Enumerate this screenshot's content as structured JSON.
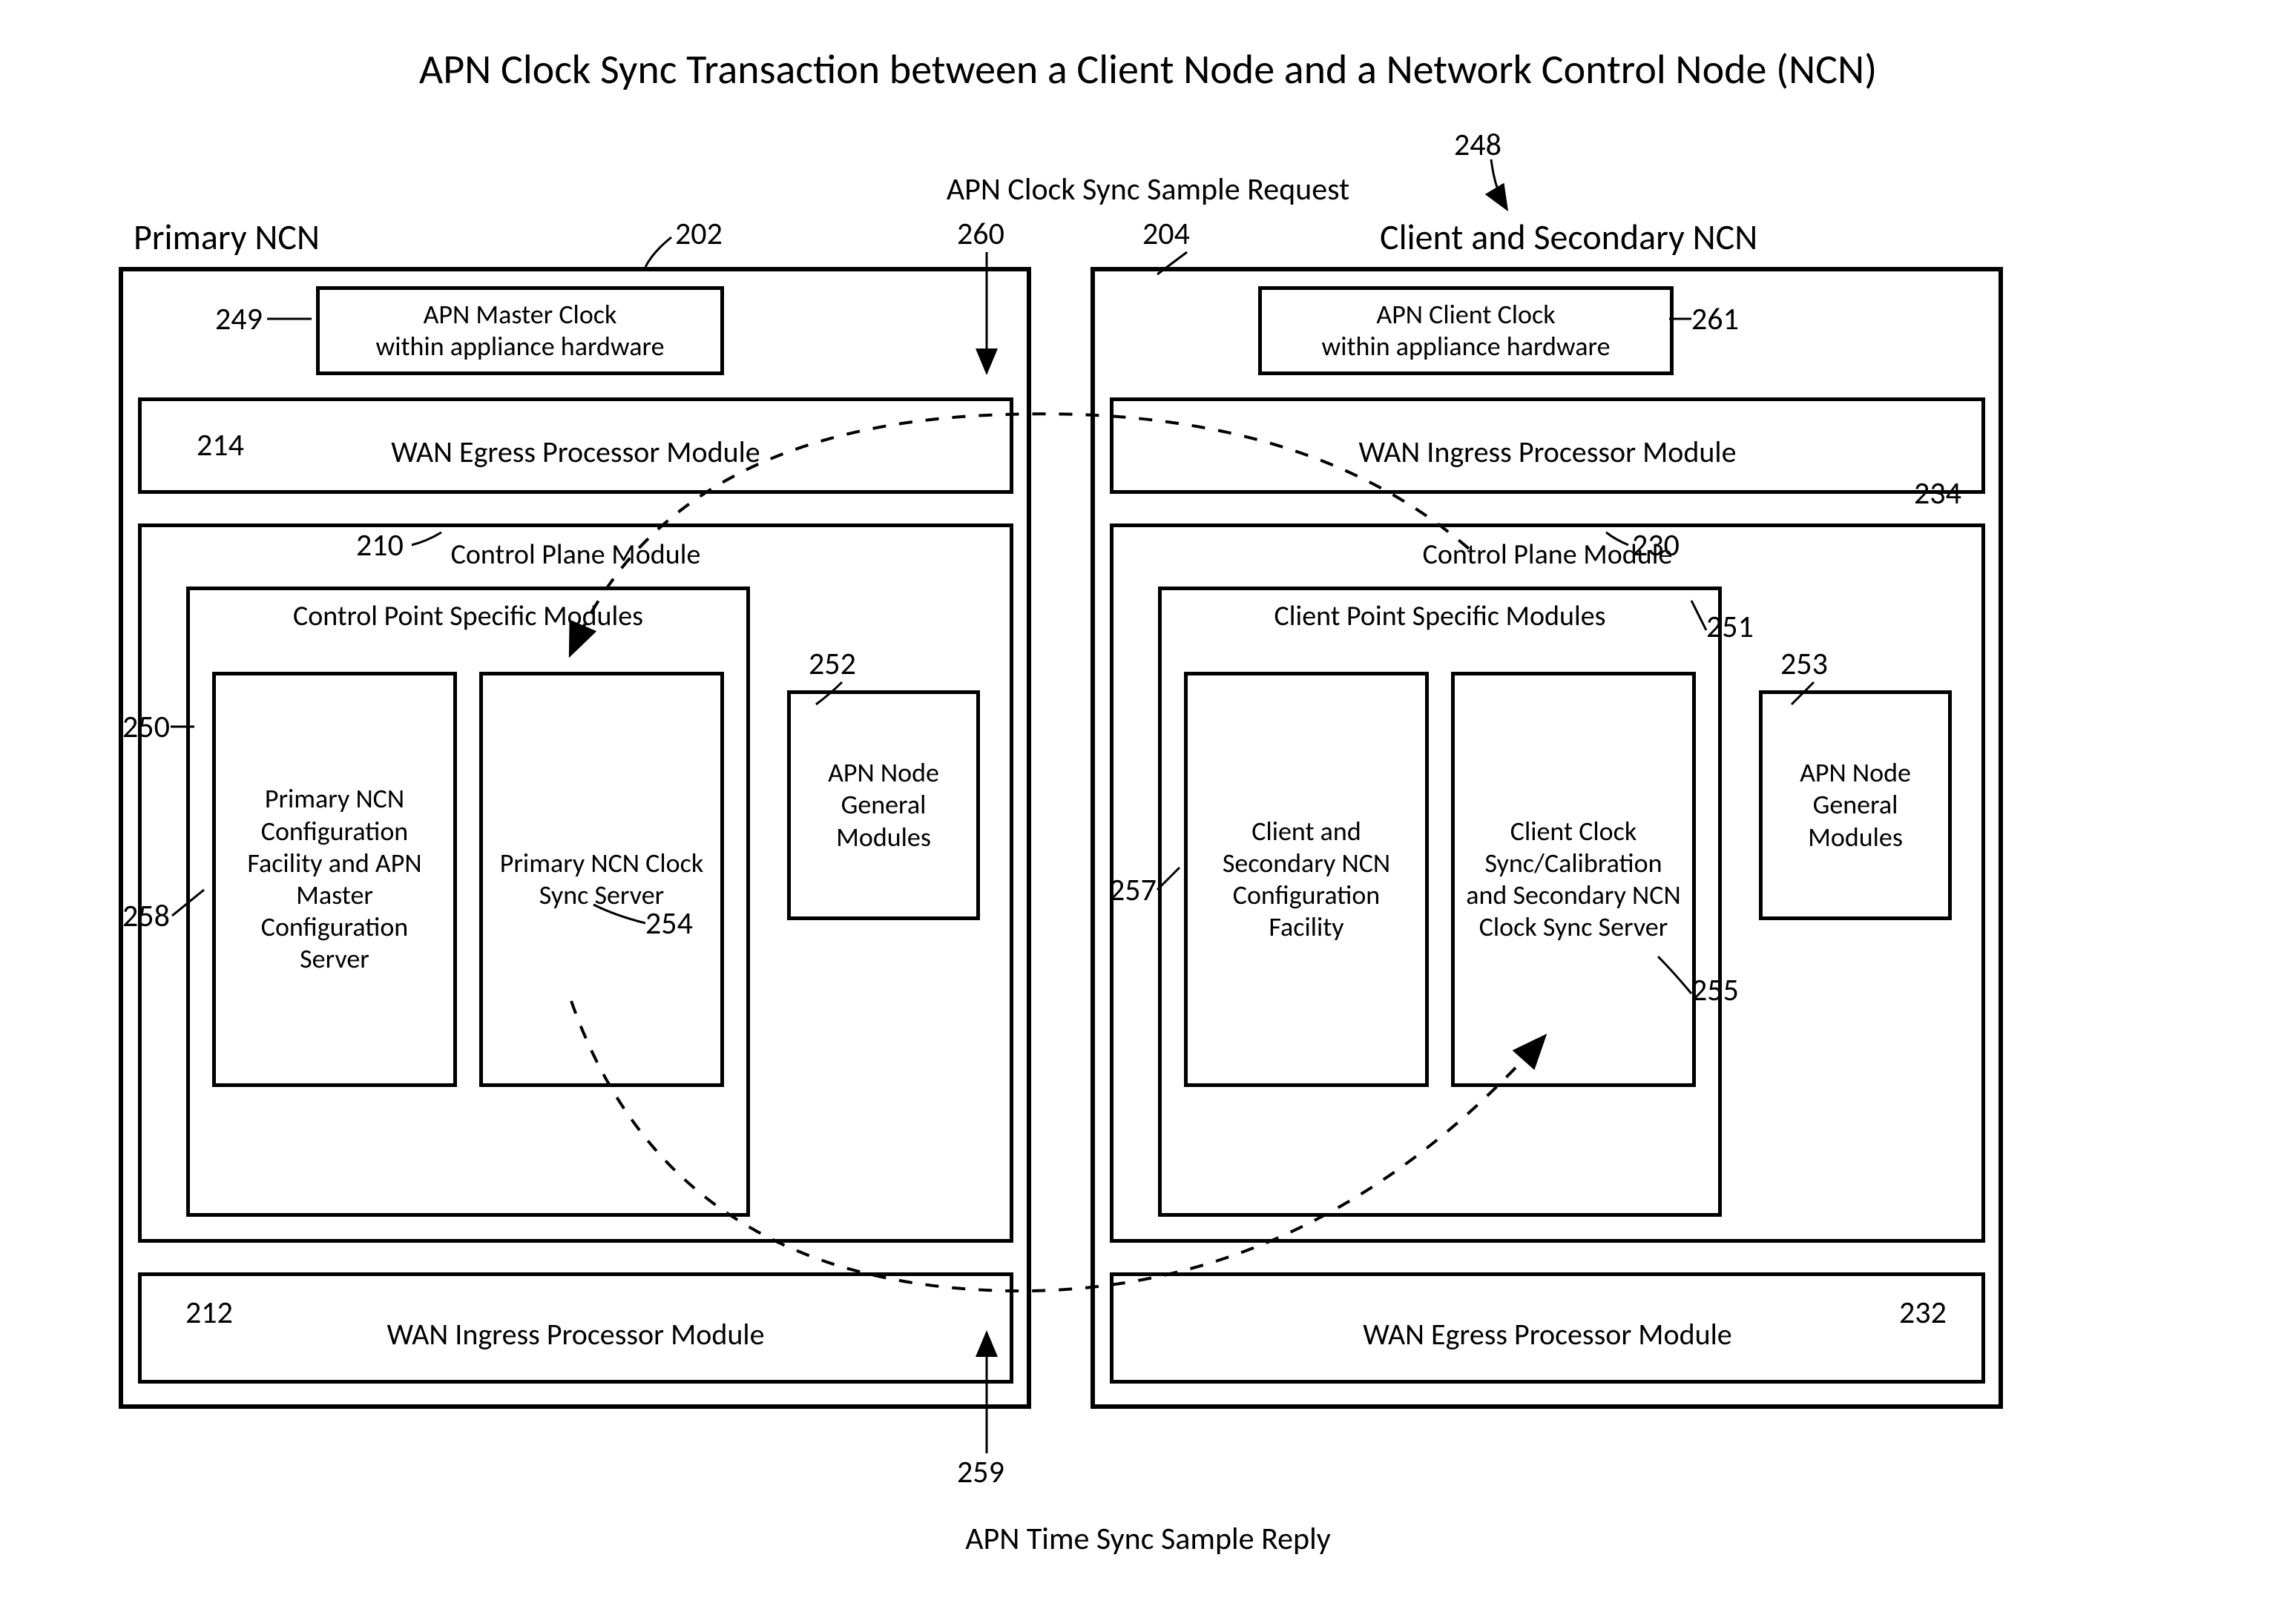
{
  "title": "APN Clock Sync Transaction between a Client Node and a Network Control Node (NCN)",
  "top_flow_label": "APN Clock Sync Sample Request",
  "bottom_flow_label": "APN Time Sync Sample Reply",
  "left": {
    "header": "Primary NCN",
    "clock_box": "APN Master Clock\nwithin appliance hardware",
    "wan_egress": "WAN Egress Processor Module",
    "wan_ingress": "WAN Ingress Processor Module",
    "control_plane": "Control Plane Module",
    "specific_header": "Control Point Specific Modules",
    "mod_config": "Primary NCN Configuration Facility and APN Master Configuration Server",
    "mod_sync": "Primary NCN Clock Sync Server",
    "mod_general": "APN Node General Modules"
  },
  "right": {
    "header": "Client and Secondary NCN",
    "clock_box": "APN Client Clock\nwithin appliance hardware",
    "wan_ingress": "WAN Ingress Processor Module",
    "wan_egress": "WAN Egress Processor Module",
    "control_plane": "Control Plane Module",
    "specific_header": "Client Point Specific Modules",
    "mod_config": "Client and Secondary NCN Configuration Facility",
    "mod_sync": "Client Clock Sync/Calibration and Secondary NCN Clock Sync Server",
    "mod_general": "APN Node General Modules"
  },
  "refs": {
    "r248": "248",
    "r202": "202",
    "r204": "204",
    "r249": "249",
    "r261": "261",
    "r260": "260",
    "r214": "214",
    "r234": "234",
    "r210": "210",
    "r230": "230",
    "r250": "250",
    "r251": "251",
    "r258": "258",
    "r252": "252",
    "r253": "253",
    "r254": "254",
    "r255": "255",
    "r257": "257",
    "r212": "212",
    "r232": "232",
    "r259": "259"
  }
}
